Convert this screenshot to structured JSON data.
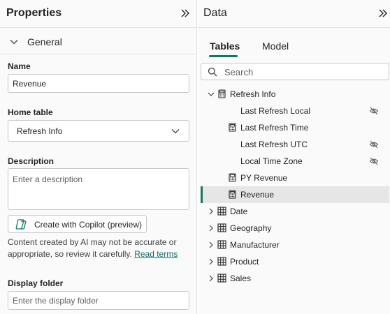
{
  "properties": {
    "title": "Properties",
    "section": "General",
    "name_label": "Name",
    "name_value": "Revenue",
    "home_table_label": "Home table",
    "home_table_value": "Refresh Info",
    "description_label": "Description",
    "description_placeholder": "Enter a description",
    "copilot_button": "Create with Copilot (preview)",
    "disclaimer_text": "Content created by AI may not be accurate or appropriate, so review it carefully.",
    "disclaimer_link": "Read terms",
    "display_folder_label": "Display folder",
    "display_folder_placeholder": "Enter the display folder"
  },
  "data_pane": {
    "title": "Data",
    "tabs": [
      "Tables",
      "Model"
    ],
    "active_tab": "Tables",
    "search_placeholder": "Search",
    "tree": [
      {
        "label": "Refresh Info",
        "type": "table-calc",
        "level": 0,
        "expanded": true
      },
      {
        "label": "Last Refresh Local",
        "type": "column",
        "level": 1,
        "hidden": true
      },
      {
        "label": "Last Refresh Time",
        "type": "measure",
        "level": 1,
        "hidden": false
      },
      {
        "label": "Last Refresh UTC",
        "type": "column",
        "level": 1,
        "hidden": true
      },
      {
        "label": "Local Time Zone",
        "type": "column",
        "level": 1,
        "hidden": true
      },
      {
        "label": "PY Revenue",
        "type": "measure",
        "level": 1,
        "hidden": false
      },
      {
        "label": "Revenue",
        "type": "measure",
        "level": 1,
        "hidden": false,
        "selected": true
      },
      {
        "label": "Date",
        "type": "table",
        "level": 0,
        "expanded": false
      },
      {
        "label": "Geography",
        "type": "table",
        "level": 0,
        "expanded": false
      },
      {
        "label": "Manufacturer",
        "type": "table",
        "level": 0,
        "expanded": false
      },
      {
        "label": "Product",
        "type": "table",
        "level": 0,
        "expanded": false
      },
      {
        "label": "Sales",
        "type": "table",
        "level": 0,
        "expanded": false
      }
    ]
  },
  "colors": {
    "accent": "#117865",
    "link": "#0f6c6c"
  }
}
